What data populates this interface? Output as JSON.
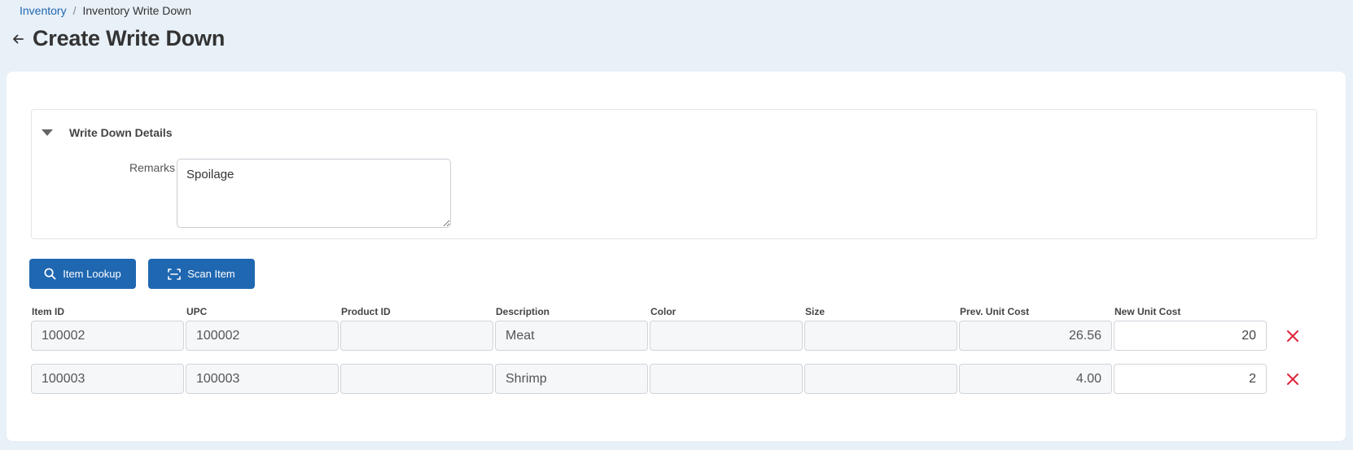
{
  "breadcrumb": {
    "parent": "Inventory",
    "separator": "/",
    "current": "Inventory Write Down"
  },
  "page": {
    "title": "Create Write Down"
  },
  "details": {
    "title": "Write Down Details",
    "remarks_label": "Remarks",
    "remarks_value": "Spoilage"
  },
  "actions": {
    "item_lookup": "Item Lookup",
    "scan_item": "Scan Item"
  },
  "table": {
    "headers": [
      "Item ID",
      "UPC",
      "Product ID",
      "Description",
      "Color",
      "Size",
      "Prev. Unit Cost",
      "New Unit Cost"
    ],
    "rows": [
      [
        "100002",
        "100002",
        "",
        "Meat",
        "",
        "",
        "26.56",
        "20"
      ],
      [
        "100003",
        "100003",
        "",
        "Shrimp",
        "",
        "",
        "4.00",
        "2"
      ]
    ]
  },
  "icons": {
    "back": "arrow-left-icon",
    "collapse": "caret-down-icon",
    "lookup": "search-icon",
    "scan": "scan-icon",
    "delete": "close-icon"
  },
  "colors": {
    "accent": "#1f67b1",
    "delete": "#e0243a",
    "background": "#e8f0f8"
  }
}
